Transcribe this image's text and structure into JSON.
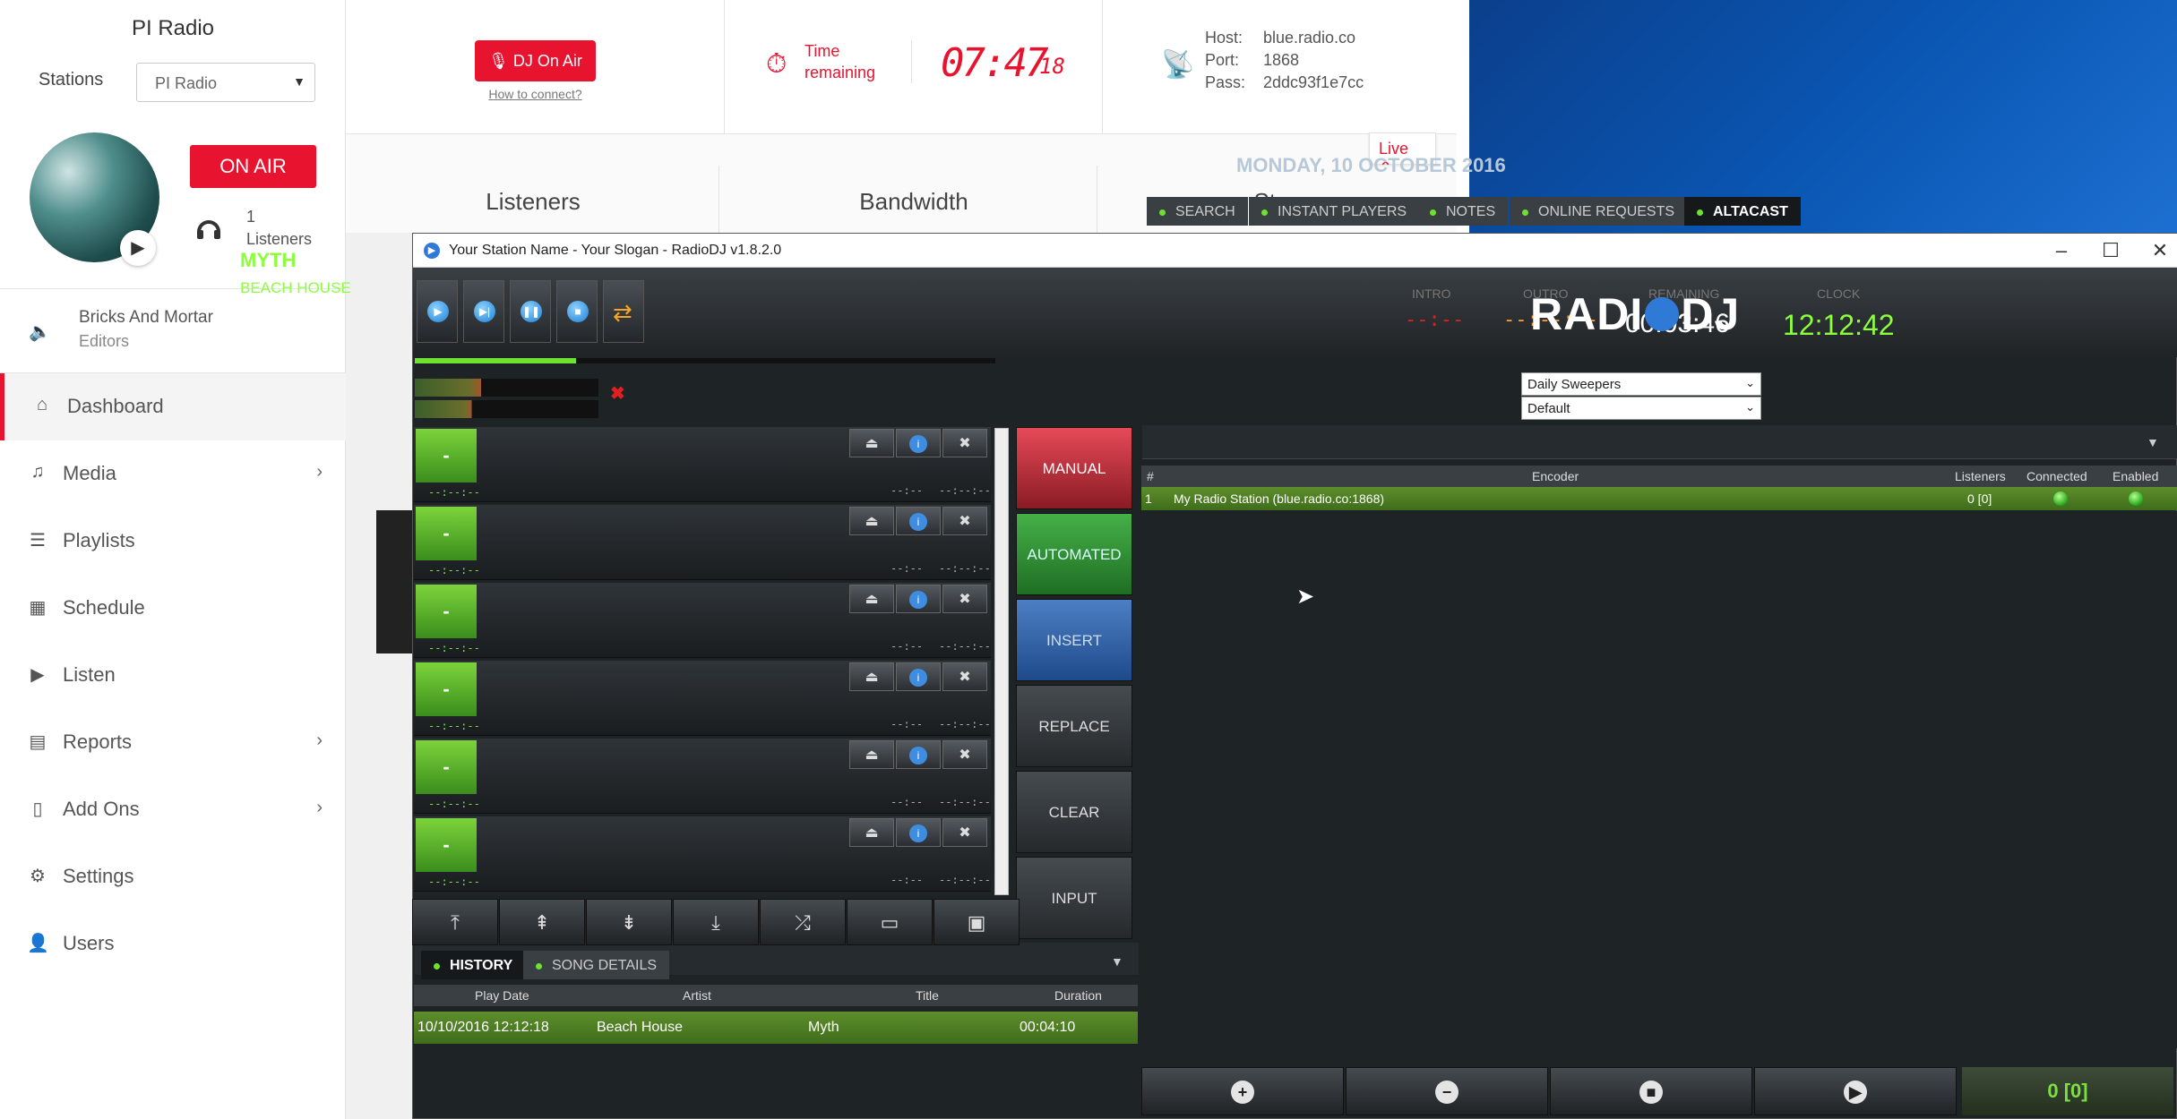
{
  "sidebar": {
    "title": "PI Radio",
    "stations_label": "Stations",
    "station_selected": "PI Radio",
    "on_air_label": "ON AIR",
    "listener_count": "1",
    "listener_label": "Listeners",
    "now_playing_title": "Bricks And Mortar",
    "now_playing_sub": "Editors",
    "nav": [
      {
        "label": "Dashboard",
        "icon": "home-icon"
      },
      {
        "label": "Media",
        "icon": "music-note-icon"
      },
      {
        "label": "Playlists",
        "icon": "list-icon"
      },
      {
        "label": "Schedule",
        "icon": "calendar-icon"
      },
      {
        "label": "Listen",
        "icon": "play-icon"
      },
      {
        "label": "Reports",
        "icon": "report-icon"
      },
      {
        "label": "Add Ons",
        "icon": "mobile-icon"
      },
      {
        "label": "Settings",
        "icon": "gear-icon"
      },
      {
        "label": "Users",
        "icon": "user-icon"
      }
    ]
  },
  "topbar": {
    "dj_button": "DJ On Air",
    "how_to_connect": "How to connect?",
    "time_label_1": "Time",
    "time_label_2": "remaining",
    "time_main": "07:47",
    "time_sec": "18",
    "host_key": "Host:",
    "host_val": "blue.radio.co",
    "port_key": "Port:",
    "port_val": "1868",
    "pass_key": "Pass:",
    "pass_val": "2ddc93f1e7cc",
    "live_label": "Live",
    "stats": [
      "Listeners",
      "Bandwidth",
      "Storage"
    ]
  },
  "radiodj": {
    "window_title": "Your Station Name - Your Slogan - RadioDJ v1.8.2.0",
    "song_title": "MYTH",
    "song_artist": "BEACH HOUSE",
    "intro_label": "INTRO",
    "intro_val": "--:--",
    "outro_label": "OUTRO",
    "outro_val": "--:--:--",
    "remaining_label": "REMAINING",
    "remaining_val": "00:03:46",
    "clock_label": "CLOCK",
    "clock_val": "12:12:42",
    "logo_left": "RADI",
    "logo_right": "DJ",
    "date": "MONDAY, 10 OCTOBER 2016",
    "dropdown_1": "Daily Sweepers",
    "dropdown_2": "Default",
    "player_button": "-",
    "player_time_left": "--:--:--",
    "player_time_mid": "--:--",
    "player_time_right": "--:--:--",
    "modes": [
      "MANUAL",
      "AUTOMATED",
      "INSERT",
      "REPLACE",
      "CLEAR",
      "INPUT"
    ],
    "tabs": [
      "SEARCH",
      "INSTANT PLAYERS",
      "NOTES",
      "ONLINE REQUESTS",
      "ALTACAST"
    ],
    "encoder_headers": [
      "#",
      "Encoder",
      "Listeners",
      "Connected",
      "Enabled"
    ],
    "encoder_row": {
      "num": "1",
      "name": "My Radio Station (blue.radio.co:1868)",
      "listeners": "0 [0]"
    },
    "total_count": "0 [0]",
    "history_tabs": [
      "HISTORY",
      "SONG DETAILS"
    ],
    "history_headers": [
      "Play Date",
      "Artist",
      "Title",
      "Duration"
    ],
    "history_row": {
      "date": "10/10/2016 12:12:18",
      "artist": "Beach House",
      "title": "Myth",
      "duration": "00:04:10"
    }
  },
  "colors": {
    "accent_red": "#e8132f",
    "dj_green": "#8cff3c",
    "remaining_white": "#ffffff",
    "clock_green": "#8cff3c",
    "intro_red": "#e02020",
    "outro_orange": "#ff9f2e"
  }
}
